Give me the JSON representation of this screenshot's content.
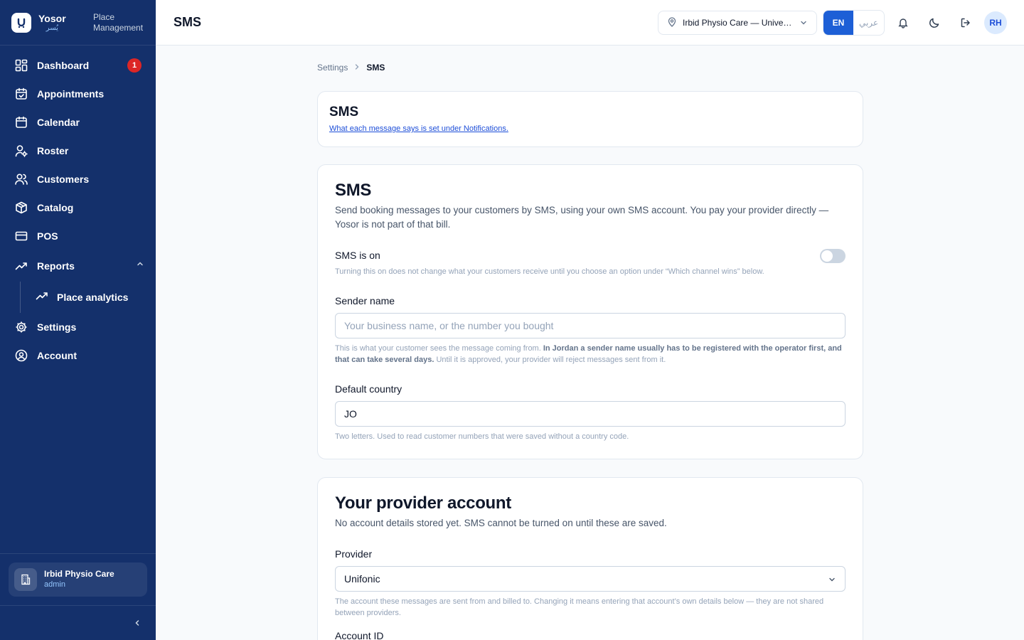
{
  "brand": {
    "name": "Yosor",
    "name_ar": "يُسر",
    "subtitle_line1": "Place",
    "subtitle_line2": "Management"
  },
  "sidebar": {
    "items": [
      {
        "label": "Dashboard",
        "icon": "dashboard-icon",
        "badge": "1"
      },
      {
        "label": "Appointments",
        "icon": "calendar-check-icon"
      },
      {
        "label": "Calendar",
        "icon": "calendar-icon"
      },
      {
        "label": "Roster",
        "icon": "user-gear-icon"
      },
      {
        "label": "Customers",
        "icon": "users-icon"
      },
      {
        "label": "Catalog",
        "icon": "box-icon"
      },
      {
        "label": "POS",
        "icon": "credit-card-icon"
      },
      {
        "label": "Reports",
        "icon": "trend-icon"
      }
    ],
    "sub_item": {
      "label": "Place analytics",
      "icon": "trend-icon"
    },
    "items_after": [
      {
        "label": "Settings",
        "icon": "gear-icon"
      },
      {
        "label": "Account",
        "icon": "user-circle-icon"
      }
    ],
    "place": {
      "name": "Irbid Physio Care",
      "role": "admin"
    }
  },
  "topbar": {
    "title": "SMS",
    "location": "Irbid Physio Care — University Street",
    "lang_en": "EN",
    "lang_ar": "عربي",
    "avatar": "RH"
  },
  "breadcrumb": {
    "parent": "Settings",
    "current": "SMS"
  },
  "header_card": {
    "title": "SMS",
    "link": "What each message says is set under Notifications."
  },
  "sms_card": {
    "title": "SMS",
    "description": "Send booking messages to your customers by SMS, using your own SMS account. You pay your provider directly — Yosor is not part of that bill.",
    "toggle_label": "SMS is on",
    "toggle_on": false,
    "toggle_hint": "Turning this on does not change what your customers receive until you choose an option under “Which channel wins” below.",
    "sender_label": "Sender name",
    "sender_placeholder": "Your business name, or the number you bought",
    "sender_hint_a": "This is what your customer sees the message coming from. ",
    "sender_hint_b": "In Jordan a sender name usually has to be registered with the operator first, and that can take several days.",
    "sender_hint_c": " Until it is approved, your provider will reject messages sent from it.",
    "country_label": "Default country",
    "country_value": "JO",
    "country_hint": "Two letters. Used to read customer numbers that were saved without a country code."
  },
  "provider_card": {
    "title": "Your provider account",
    "description": "No account details stored yet. SMS cannot be turned on until these are saved.",
    "provider_label": "Provider",
    "provider_value": "Unifonic",
    "provider_hint": "The account these messages are sent from and billed to. Changing it means entering that account’s own details below — they are not shared between providers.",
    "account_id_label": "Account ID"
  },
  "colors": {
    "sidebar": "#14306b",
    "accent": "#1d5fd6",
    "badge": "#dc2626"
  }
}
